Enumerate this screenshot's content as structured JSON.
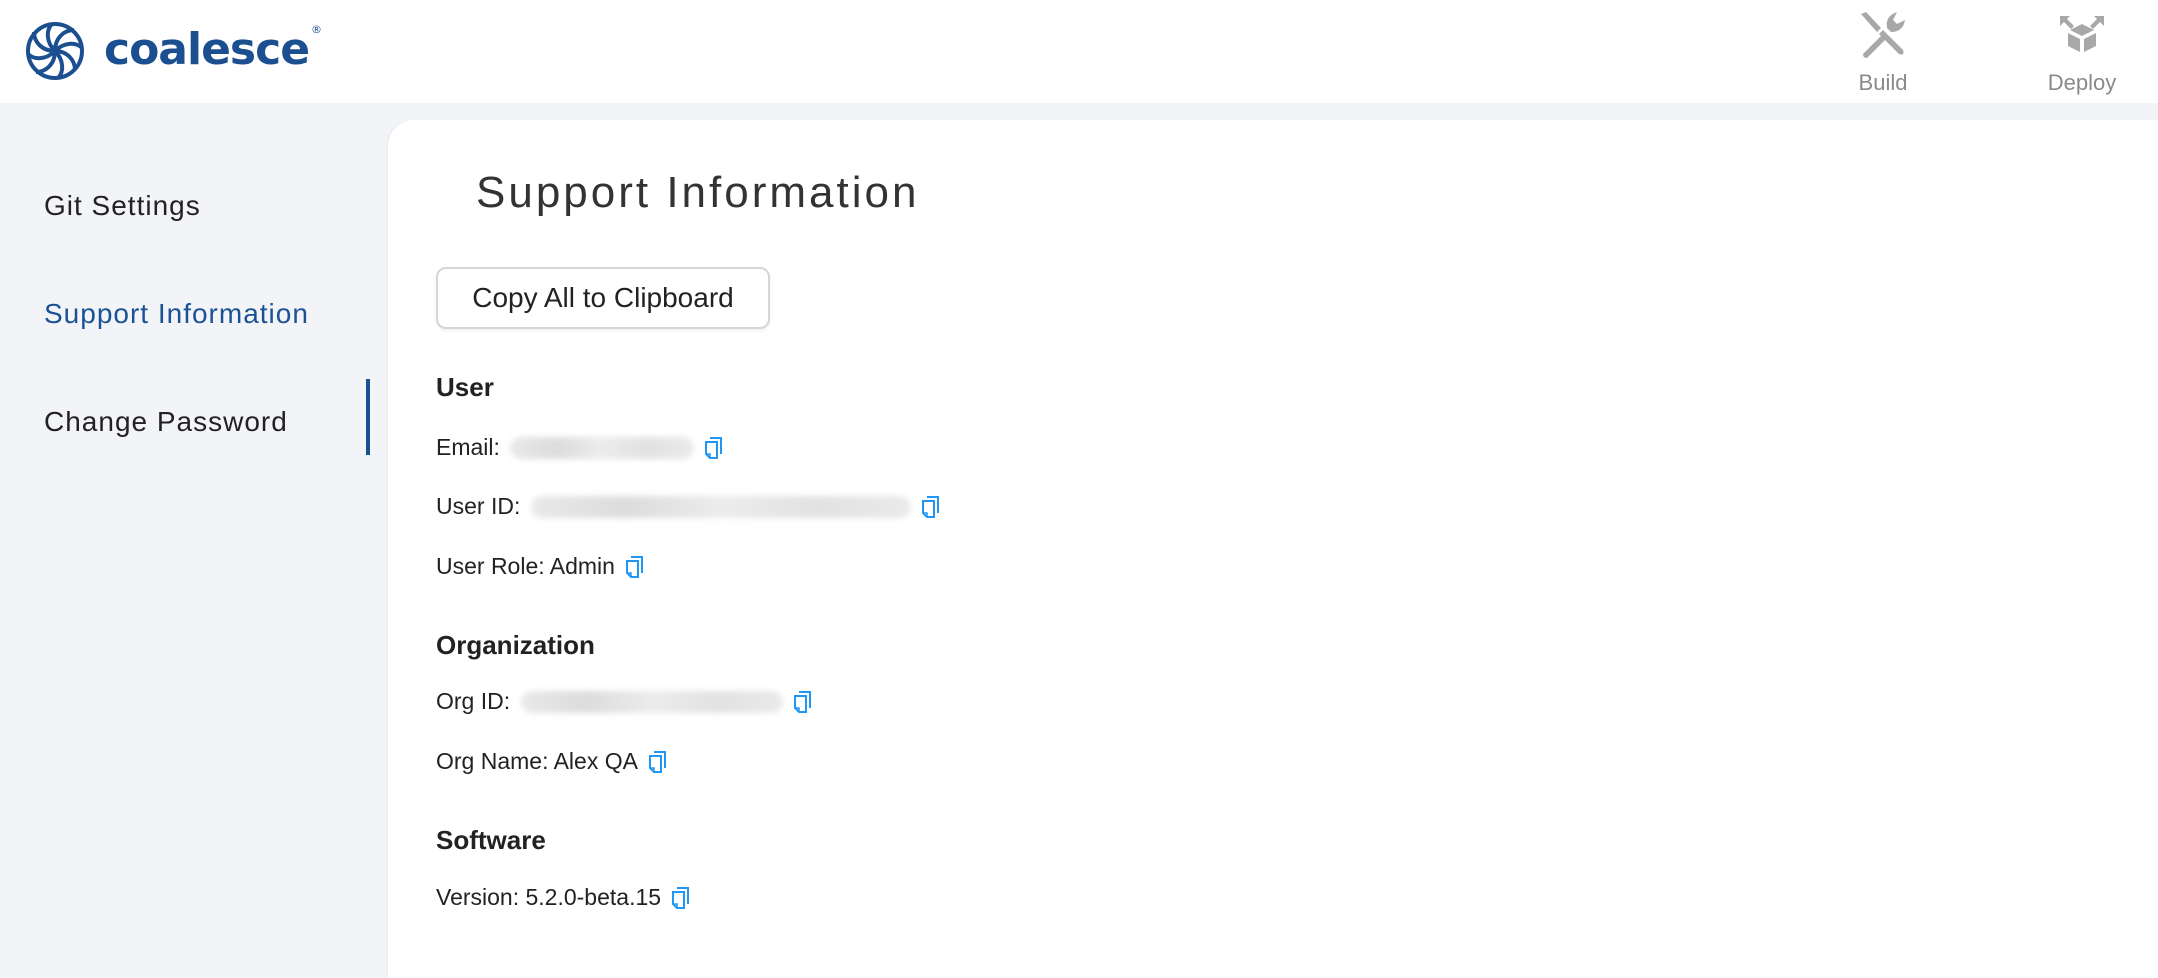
{
  "app": {
    "logo_text": "coalesce",
    "logo_reg": "®",
    "brand_color": "#1b4f8f",
    "accent_color": "#1b5294",
    "copy_icon_color": "#2196f3"
  },
  "topnav": [
    {
      "label": "Build",
      "icon": "build-tools-icon"
    },
    {
      "label": "Deploy",
      "icon": "deploy-box-icon"
    }
  ],
  "sidebar": {
    "items": [
      {
        "label": "Git Settings",
        "active": false
      },
      {
        "label": "Support Information",
        "active": true
      },
      {
        "label": "Change Password",
        "active": false
      }
    ]
  },
  "main": {
    "title": "Support Information",
    "copy_all_label": "Copy All to Clipboard",
    "sections": {
      "user": {
        "heading": "User",
        "email_label": "Email: ",
        "email_value": "[redacted]",
        "user_id_label": "User ID: ",
        "user_id_value": "[redacted]",
        "role_label": "User Role: Admin"
      },
      "organization": {
        "heading": "Organization",
        "org_id_label": "Org ID: ",
        "org_id_value": "[redacted]",
        "org_name_label": "Org Name: Alex QA"
      },
      "software": {
        "heading": "Software",
        "version_label": "Version: 5.2.0-beta.15"
      }
    }
  }
}
